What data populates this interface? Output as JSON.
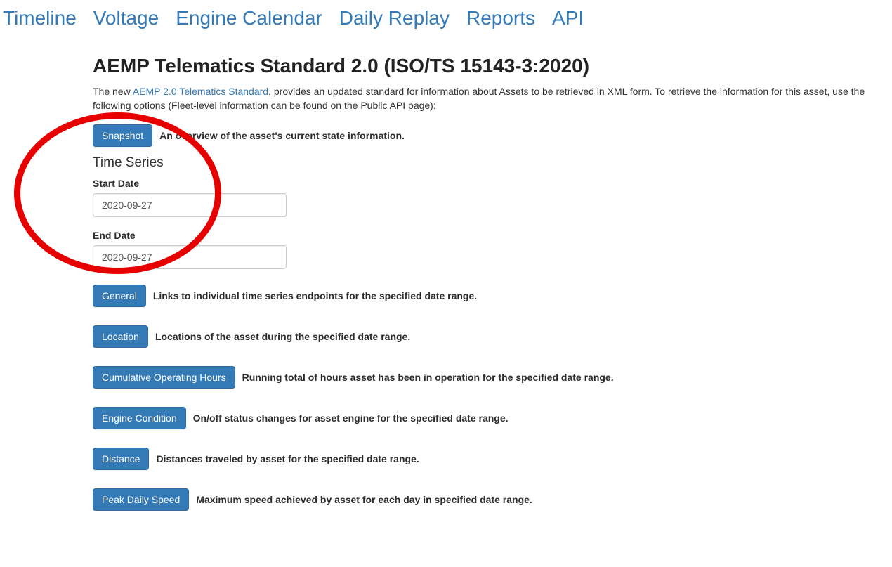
{
  "nav": {
    "items": [
      {
        "label": "Timeline"
      },
      {
        "label": "Voltage"
      },
      {
        "label": "Engine Calendar"
      },
      {
        "label": "Daily Replay"
      },
      {
        "label": "Reports"
      },
      {
        "label": "API"
      }
    ]
  },
  "heading": "AEMP Telematics Standard 2.0 (ISO/TS 15143-3:2020)",
  "intro_prefix": "The new ",
  "intro_link": "AEMP 2.0 Telematics Standard",
  "intro_suffix": ", provides an updated standard for information about Assets to be retrieved in XML form. To retrieve the information for this asset, use the following options (Fleet-level information can be found on the Public API page):",
  "snapshot": {
    "button": "Snapshot",
    "desc": "An overview of the asset's current state information."
  },
  "timeseries_heading": "Time Series",
  "start_date": {
    "label": "Start Date",
    "value": "2020-09-27"
  },
  "end_date": {
    "label": "End Date",
    "value": "2020-09-27"
  },
  "rows": [
    {
      "button": "General",
      "desc": "Links to individual time series endpoints for the specified date range."
    },
    {
      "button": "Location",
      "desc": "Locations of the asset during the specified date range."
    },
    {
      "button": "Cumulative Operating Hours",
      "desc": "Running total of hours asset has been in operation for the specified date range."
    },
    {
      "button": "Engine Condition",
      "desc": "On/off status changes for asset engine for the specified date range."
    },
    {
      "button": "Distance",
      "desc": "Distances traveled by asset for the specified date range."
    },
    {
      "button": "Peak Daily Speed",
      "desc": "Maximum speed achieved by asset for each day in specified date range."
    }
  ]
}
